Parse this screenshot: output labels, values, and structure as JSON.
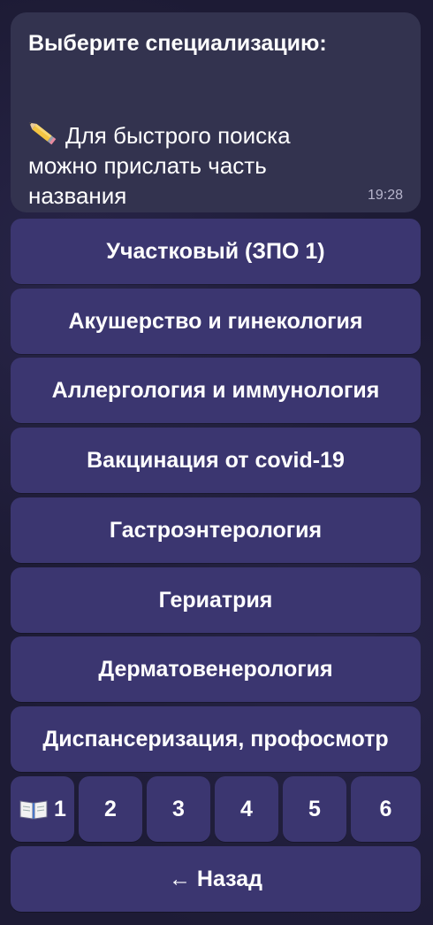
{
  "message": {
    "title": "Выберите специализацию:",
    "hint_icon": "pencil-icon",
    "hint": "Для быстрого поиска\nможно прислать часть\nназвания",
    "time": "19:28"
  },
  "specializations": [
    "Участковый (ЗПО 1)",
    "Акушерство и гинекология",
    "Аллергология и иммунология",
    "Вакцинация от covid-19",
    "Гастроэнтерология",
    "Гериатрия",
    "Дерматовенерология",
    "Диспансеризация, профосмотр"
  ],
  "pagination": {
    "current_icon": "open-book-icon",
    "pages": [
      "1",
      "2",
      "3",
      "4",
      "5",
      "6"
    ]
  },
  "back_label": "← Назад",
  "colors": {
    "background": "#1d1b35",
    "bubble": "#33334f",
    "button": "#3b3670",
    "time": "#b7b5cc"
  }
}
